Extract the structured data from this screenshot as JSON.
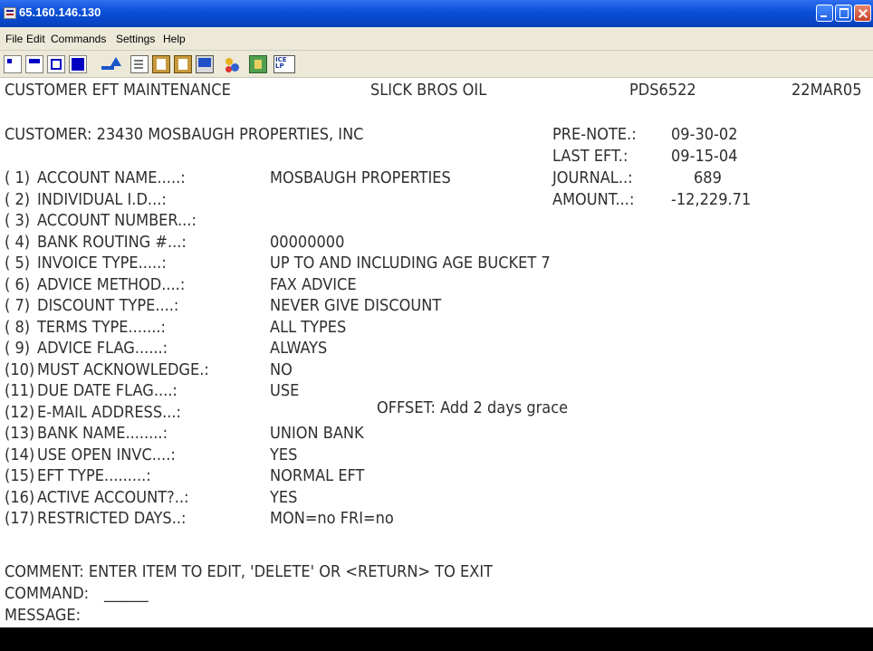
{
  "window": {
    "title": "65.160.146.130",
    "title_bar_color": "#0a4fd6"
  },
  "menu": {
    "items": [
      "File",
      "Edit",
      "Commands",
      "Settings",
      "Help"
    ]
  },
  "toolbar": {
    "icons": [
      "color-swatch-1-icon",
      "color-swatch-2-icon",
      "color-swatch-3-icon",
      "color-swatch-4-icon",
      "send-arrow-icon",
      "copy-icon",
      "paste-icon",
      "paste-special-icon",
      "screen-icon",
      "colors-icon",
      "macro-icon",
      "ice-lp-print-icon"
    ],
    "print_icon_text": "ICE LP"
  },
  "screen": {
    "header": {
      "screen_title": "CUSTOMER EFT MAINTENANCE",
      "company": "SLICK BROS OIL",
      "program_id": "PDS6522",
      "date": "22MAR05"
    },
    "customer_line": "CUSTOMER: 23430 MOSBAUGH PROPERTIES, INC",
    "right_info": [
      {
        "label": "PRE-NOTE.:",
        "value": "09-30-02"
      },
      {
        "label": "LAST EFT.:",
        "value": "09-15-04"
      },
      {
        "label": "JOURNAL..:",
        "value": "689"
      },
      {
        "label": "AMOUNT...:",
        "value": "-12,229.71"
      }
    ],
    "fields": [
      {
        "num": "( 1)",
        "label": "ACCOUNT NAME.....:",
        "value": "MOSBAUGH PROPERTIES"
      },
      {
        "num": "( 2)",
        "label": "INDIVIDUAL I.D...:",
        "value": ""
      },
      {
        "num": "( 3)",
        "label": "ACCOUNT NUMBER...:",
        "value": ""
      },
      {
        "num": "( 4)",
        "label": "BANK ROUTING #...:",
        "value": "00000000"
      },
      {
        "num": "( 5)",
        "label": "INVOICE TYPE.....:",
        "value": "UP TO AND INCLUDING AGE BUCKET 7"
      },
      {
        "num": "( 6)",
        "label": "ADVICE METHOD....:",
        "value": "FAX ADVICE"
      },
      {
        "num": "( 7)",
        "label": "DISCOUNT TYPE....:",
        "value": "NEVER GIVE DISCOUNT"
      },
      {
        "num": "( 8)",
        "label": "TERMS TYPE.......:",
        "value": "ALL TYPES"
      },
      {
        "num": "( 9)",
        "label": "ADVICE FLAG......:",
        "value": "ALWAYS"
      },
      {
        "num": "(10)",
        "label": "MUST ACKNOWLEDGE.:",
        "value": "NO"
      },
      {
        "num": "(11)",
        "label": "DUE DATE FLAG....:",
        "value": "USE"
      },
      {
        "num": "(12)",
        "label": "E-MAIL ADDRESS...:",
        "value": ""
      },
      {
        "num": "(13)",
        "label": "BANK NAME........:",
        "value": "UNION BANK"
      },
      {
        "num": "(14)",
        "label": "USE OPEN INVC....:",
        "value": "YES"
      },
      {
        "num": "(15)",
        "label": "EFT TYPE.........:",
        "value": "NORMAL EFT"
      },
      {
        "num": "(16)",
        "label": "ACTIVE ACCOUNT?..:",
        "value": "YES"
      },
      {
        "num": "(17)",
        "label": "RESTRICTED DAYS..:",
        "value": "MON=no FRI=no"
      }
    ],
    "offset_note": "OFFSET: Add 2 days grace",
    "comment": "COMMENT: ENTER ITEM TO EDIT, 'DELETE' OR <RETURN> TO EXIT",
    "command_label": "COMMAND:",
    "command_value": "______",
    "message_label": "MESSAGE:",
    "text_color": "#2f2f2f",
    "background_color": "#ffffff"
  }
}
